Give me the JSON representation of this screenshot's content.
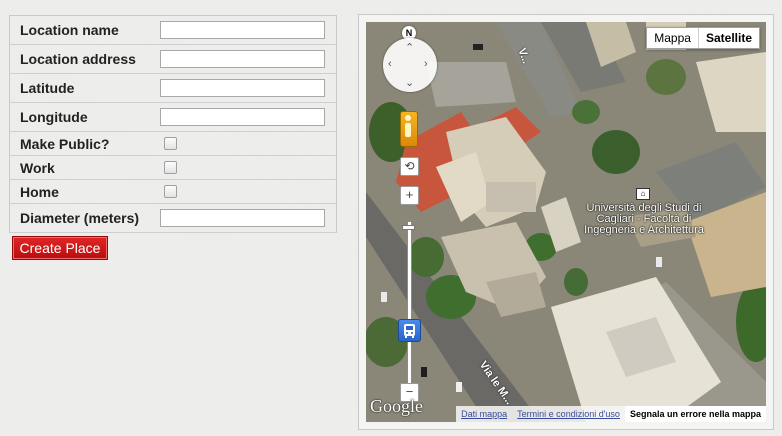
{
  "form": {
    "fields": [
      {
        "label": "Location name",
        "value": "",
        "type": "text"
      },
      {
        "label": "Location address",
        "value": "",
        "type": "text"
      },
      {
        "label": "Latitude",
        "value": "",
        "type": "text"
      },
      {
        "label": "Longitude",
        "value": "",
        "type": "text"
      },
      {
        "label": "Make Public?",
        "checked": false,
        "type": "checkbox"
      },
      {
        "label": "Work",
        "checked": false,
        "type": "checkbox"
      },
      {
        "label": "Home",
        "checked": false,
        "type": "checkbox"
      },
      {
        "label": "Diameter (meters)",
        "value": "",
        "type": "text"
      }
    ],
    "submit_label": "Create Place"
  },
  "map": {
    "type_control": {
      "map_label": "Mappa",
      "satellite_label": "Satellite",
      "selected": "Satellite"
    },
    "compass_label": "N",
    "zoom": {
      "plus": "+",
      "minus": "−",
      "level_fraction": 0.0
    },
    "poi_label": "Università degli Studi di Cagliari - Facoltà di Ingegneria e Architettura",
    "street_label_1": "Via le M...",
    "street_label_2": "V...",
    "google_logo": "Google",
    "attribution": {
      "data_link": "Dati mappa",
      "terms_link": "Termini e condizioni d'uso",
      "report_link": "Segnala un errore nella mappa"
    },
    "colors": {
      "roof_red": "#c8563d",
      "building_white": "#e6e2d6",
      "road": "#6e6e6a",
      "green": "#3f6e2e"
    }
  }
}
